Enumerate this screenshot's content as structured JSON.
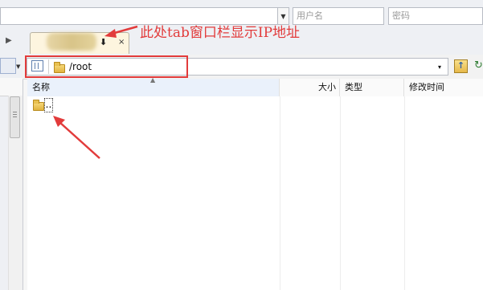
{
  "connection": {
    "username_placeholder": "用户名",
    "password_placeholder": "密码"
  },
  "tab": {
    "close_label": "×",
    "transfer_icon": "download-arrow-icon"
  },
  "address": {
    "path": "/root",
    "dropdown_glyph": "▾"
  },
  "columns": {
    "name": "名称",
    "size": "大小",
    "type": "类型",
    "modified": "修改时间"
  },
  "files": [
    {
      "name": "..",
      "kind": "parent-folder"
    }
  ],
  "annotation": {
    "text": "此处tab窗口栏显示IP地址",
    "color": "#e23b3b"
  },
  "colors": {
    "accent_red": "#e23b3b",
    "folder_yellow": "#e8c04f",
    "header_bg": "#fafafa",
    "tab_bg": "#fdf5df"
  }
}
